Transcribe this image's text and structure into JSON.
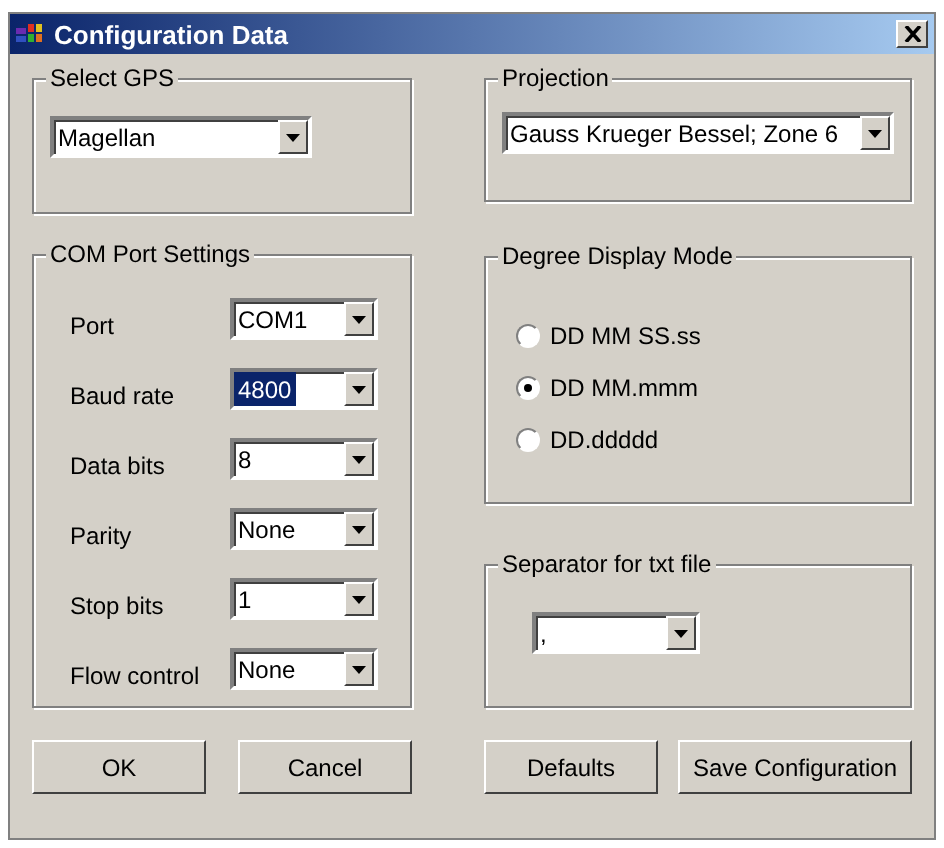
{
  "window": {
    "title": "Configuration Data"
  },
  "select_gps": {
    "legend": "Select GPS",
    "value": "Magellan"
  },
  "projection": {
    "legend": "Projection",
    "value": "Gauss Krueger Bessel; Zone 6"
  },
  "com_port": {
    "legend": "COM Port Settings",
    "fields": [
      {
        "label": "Port",
        "value": "COM1",
        "highlighted": false
      },
      {
        "label": "Baud rate",
        "value": "4800",
        "highlighted": true
      },
      {
        "label": "Data bits",
        "value": "8",
        "highlighted": false
      },
      {
        "label": "Parity",
        "value": "None",
        "highlighted": false
      },
      {
        "label": "Stop bits",
        "value": "1",
        "highlighted": false
      },
      {
        "label": "Flow control",
        "value": "None",
        "highlighted": false
      }
    ]
  },
  "degree_mode": {
    "legend": "Degree Display Mode",
    "options": [
      {
        "label": "DD MM SS.ss",
        "selected": false
      },
      {
        "label": "DD MM.mmm",
        "selected": true
      },
      {
        "label": "DD.ddddd",
        "selected": false
      }
    ]
  },
  "separator": {
    "legend": "Separator for txt file",
    "value": ","
  },
  "buttons": [
    "OK",
    "Cancel",
    "Defaults",
    "Save Configuration"
  ]
}
